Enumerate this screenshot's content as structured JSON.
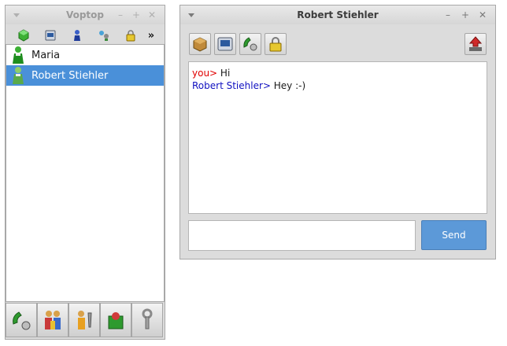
{
  "left_window": {
    "title": "Voptop",
    "toolbar_icons": [
      "green-hexagon-icon",
      "network-card-icon",
      "user-blue-icon",
      "network-icon",
      "lock-icon"
    ],
    "overflow_label": "»",
    "contacts": [
      {
        "name": "Maria",
        "icon": "user-green-icon",
        "selected": false
      },
      {
        "name": "Robert Stiehler",
        "icon": "user-green-icon",
        "selected": true
      }
    ],
    "bottom_icons": [
      "call-phone-icon",
      "group-users-icon",
      "user-settings-icon",
      "recycle-icon",
      "wrench-icon"
    ]
  },
  "right_window": {
    "title": "Robert Stiehler",
    "toolbar_icons": [
      "package-icon",
      "network-card-icon",
      "phone-call-icon",
      "lock-icon",
      "send-file-icon"
    ],
    "messages": [
      {
        "sender": "you>",
        "text": " Hi",
        "type": "you"
      },
      {
        "sender": "Robert Stiehler>",
        "text": " Hey :-)",
        "type": "them"
      }
    ],
    "input_value": "",
    "send_label": "Send"
  },
  "colors": {
    "selection": "#4a90d9",
    "send_button": "#5c99d8",
    "you_color": "#e00000",
    "them_color": "#1010c0"
  }
}
